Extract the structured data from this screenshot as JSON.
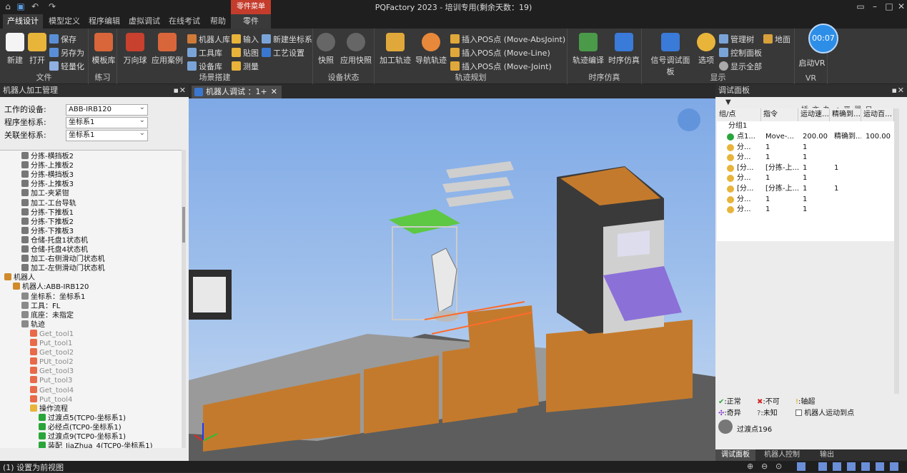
{
  "window": {
    "title": "PQFactory 2023 - 培训专用(剩余天数：19)"
  },
  "menu": {
    "tabs": [
      "产线设计",
      "模型定义",
      "程序编辑",
      "虚拟调试",
      "在线考试",
      "帮助"
    ],
    "contextual_header": "零件菜单",
    "contextual_tab": "零件"
  },
  "ribbon": {
    "file": {
      "label": "文件",
      "new": "新建",
      "open": "打开",
      "save": "保存",
      "save_as": "另存为",
      "lightweight": "轻量化"
    },
    "practice": {
      "label": "练习",
      "template": "模板库"
    },
    "scene": {
      "label": "场景搭建",
      "universal_ball": "万向球",
      "cases": "应用案例",
      "robot_lib": "机器人库",
      "tool_lib": "工具库",
      "device_lib": "设备库",
      "input": "输入",
      "texture": "贴图",
      "measure": "测量",
      "new_coord": "新建坐标系",
      "process_settings": "工艺设置"
    },
    "device_status": {
      "label": "设备状态",
      "snapshot": "快照",
      "apply_snapshot": "应用快照"
    },
    "trajectory": {
      "label": "轨迹规划",
      "add_track": "加工轨迹",
      "nav_track": "导航轨迹",
      "pos_abs": "插入POS点 (Move-AbsJoint)",
      "pos_line": "插入POS点 (Move-Line)",
      "pos_joint": "插入POS点 (Move-Joint)"
    },
    "timing": {
      "label": "时序仿真",
      "compile": "轨迹编译",
      "timing_sim": "时序仿真"
    },
    "display": {
      "label": "显示",
      "signal_panel": "信号调试面板",
      "options": "选项",
      "manage_tree": "管理树",
      "control_panel": "控制面板",
      "show_all": "显示全部",
      "ground": "地面"
    },
    "vr": {
      "label": "VR",
      "start_vr": "启动VR"
    }
  },
  "timer": "00:07",
  "left_panel": {
    "title": "机器人加工管理",
    "device_label": "工作的设备:",
    "device_value": "ABB-IRB120",
    "prog_coord_label": "程序坐标系:",
    "prog_coord_value": "坐标系1",
    "rel_coord_label": "关联坐标系:",
    "rel_coord_value": "坐标系1",
    "tree": [
      "分拣-横挡板2",
      "分拣-上推板2",
      "分拣-横挡板3",
      "分拣-上推板3",
      "加工-夹紧钳",
      "加工-工台导轨",
      "分拣-下推板1",
      "分拣-下推板2",
      "分拣-下推板3",
      "仓储-托盘1状态机",
      "仓储-托盘4状态机",
      "加工-右侧滑动门状态机",
      "加工-左侧滑动门状态机",
      "机器人",
      "机器人:ABB-IRB120",
      "坐标系：坐标系1",
      "工具：FL",
      "底座：未指定",
      "轨迹",
      "Get_tool1",
      "Put_tool1",
      "Get_tool2",
      "PUt_tool2",
      "Get_tool3",
      "Put_tool3",
      "Get_tool4",
      "Put_tool4",
      "操作流程",
      "过渡点5(TCP0-坐标系1)",
      "必经点(TCP0-坐标系1)",
      "过渡点9(TCP0-坐标系1)",
      "装配_JiaZhua_4(TCP0-坐标系1)"
    ]
  },
  "viewport": {
    "tab": "机器人调试 ：1+"
  },
  "right_panel": {
    "title": "调试面板",
    "toolbar_text": "插 亦 办 ✓ 平 器 日",
    "columns": [
      "组/点",
      "指令",
      "运动速…",
      "精确到…",
      "运动百…"
    ],
    "group": "分组1",
    "rows": [
      [
        "点1...",
        "Move-...",
        "200.00",
        "精确到...",
        "100.00"
      ],
      [
        "分...",
        "1",
        "1",
        "",
        ""
      ],
      [
        "分...",
        "1",
        "1",
        "",
        ""
      ],
      [
        "[分...",
        "[分拣-上...",
        "1",
        "1",
        ""
      ],
      [
        "分...",
        "1",
        "1",
        "",
        ""
      ],
      [
        "[分...",
        "[分拣-上...",
        "1",
        "1",
        ""
      ],
      [
        "分...",
        "1",
        "1",
        "",
        ""
      ],
      [
        "分...",
        "1",
        "1",
        "",
        ""
      ]
    ],
    "legend": {
      "normal": "正常",
      "no": "不可",
      "axis_over": "轴超",
      "singular": "奇异",
      "unknown": "未知",
      "robot_reach": "机器人运动到点"
    },
    "transition_point": "过渡点196",
    "tabs": [
      "调试面板",
      "机器人控制",
      "输出"
    ]
  },
  "status": {
    "text": "(1) 设置为前视图"
  }
}
